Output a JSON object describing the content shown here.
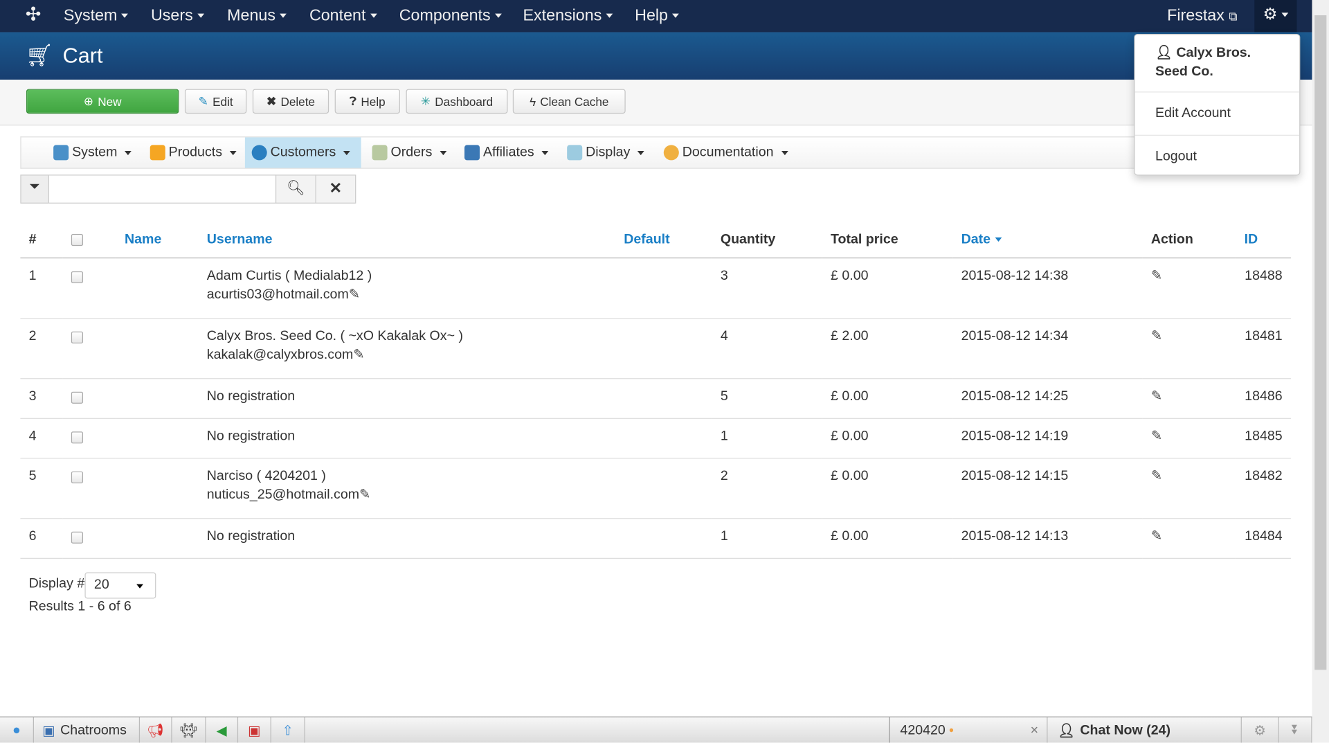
{
  "topnav": {
    "menus": [
      "System",
      "Users",
      "Menus",
      "Content",
      "Components",
      "Extensions",
      "Help"
    ],
    "site_link": "Firestax"
  },
  "header": {
    "title": "Cart"
  },
  "toolbar": {
    "new": "New",
    "edit": "Edit",
    "delete": "Delete",
    "help": "Help",
    "dashboard": "Dashboard",
    "clean_cache": "Clean Cache"
  },
  "submenu": [
    "System",
    "Products",
    "Customers",
    "Orders",
    "Affiliates",
    "Display",
    "Documentation"
  ],
  "filter": {
    "search_value": ""
  },
  "table": {
    "headers": {
      "num": "#",
      "name": "Name",
      "username": "Username",
      "default": "Default",
      "quantity": "Quantity",
      "total": "Total price",
      "date": "Date",
      "action": "Action",
      "id": "ID"
    },
    "rows": [
      {
        "num": "1",
        "user": "Adam Curtis ( Medialab12 )",
        "email": "acurtis03@hotmail.com",
        "qty": "3",
        "total": "£ 0.00",
        "date": "2015-08-12 14:38",
        "id": "18488"
      },
      {
        "num": "2",
        "user": "Calyx Bros. Seed Co. ( ~xO Kakalak Ox~ )",
        "email": "kakalak@calyxbros.com",
        "qty": "4",
        "total": "£ 2.00",
        "date": "2015-08-12 14:34",
        "id": "18481"
      },
      {
        "num": "3",
        "user": "No registration",
        "email": "",
        "qty": "5",
        "total": "£ 0.00",
        "date": "2015-08-12 14:25",
        "id": "18486"
      },
      {
        "num": "4",
        "user": "No registration",
        "email": "",
        "qty": "1",
        "total": "£ 0.00",
        "date": "2015-08-12 14:19",
        "id": "18485"
      },
      {
        "num": "5",
        "user": "Narciso ( 4204201 )",
        "email": "nuticus_25@hotmail.com",
        "qty": "2",
        "total": "£ 0.00",
        "date": "2015-08-12 14:15",
        "id": "18482"
      },
      {
        "num": "6",
        "user": "No registration",
        "email": "",
        "qty": "1",
        "total": "£ 0.00",
        "date": "2015-08-12 14:13",
        "id": "18484"
      }
    ]
  },
  "pagination": {
    "display_label": "Display #",
    "display_value": "20",
    "results": "Results 1 - 6 of 6"
  },
  "user_menu": {
    "name_line1": "Calyx Bros.",
    "name_line2": "Seed Co.",
    "edit_account": "Edit Account",
    "logout": "Logout"
  },
  "bottombar": {
    "chatrooms": "Chatrooms",
    "chat_user": "420420",
    "chat_now": "Chat Now (24)"
  }
}
